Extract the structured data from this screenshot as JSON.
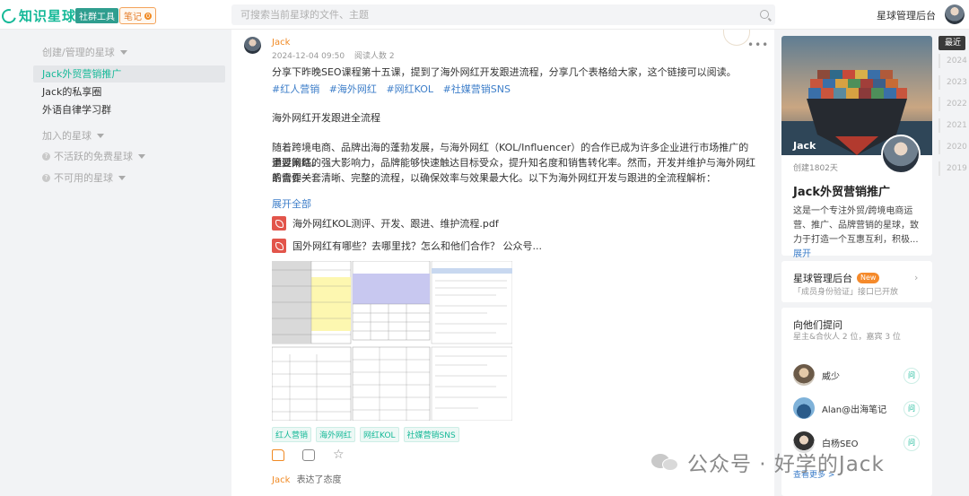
{
  "header": {
    "logo_text": "知识星球",
    "tool_badge": "社群工具",
    "note_badge": "笔记",
    "note_count": "0",
    "search_placeholder": "可搜索当前星球的文件、主题",
    "admin_link": "星球管理后台"
  },
  "sidebar": {
    "section_created": "创建/管理的星球",
    "items": [
      {
        "label": "Jack外贸营销推广",
        "active": true
      },
      {
        "label": "Jack的私享圈",
        "active": false
      },
      {
        "label": "外语自律学习群",
        "active": false
      }
    ],
    "section_joined": "加入的星球",
    "section_inactive": "不活跃的免费星球",
    "section_unavailable": "不可用的星球"
  },
  "post": {
    "author": "Jack",
    "date": "2024-12-04 09:50",
    "readers": "阅读人数 2",
    "intro": "分享下昨晚SEO课程第十五课，提到了海外网红开发跟进流程，分享几个表格给大家，这个链接可以阅读。",
    "hashtags": [
      "#红人营销",
      "#海外网红",
      "#网红KOL",
      "#社媒营销SNS"
    ],
    "heading": "海外网红开发跟进全流程",
    "body_lines": [
      "随着跨境电商、品牌出海的蓬勃发展，与海外网红（KOL/Influencer）的合作已成为许多企业进行市场推广的重要策略。",
      "通过网红的强大影响力，品牌能够快速触达目标受众，提升知名度和销售转化率。然而，开发并维护与海外网红的合作关",
      "系需要一套清晰、完整的流程，以确保效率与效果最大化。以下为海外网红开发与跟进的全流程解析："
    ],
    "expand": "展开全部",
    "files": [
      "海外网红KOL测评、开发、跟进、维护流程.pdf",
      "国外网红有哪些？去哪里找？怎么和他们合作？ 公众号..."
    ],
    "tag_chips": [
      "红人营销",
      "海外网红",
      "网红KOL",
      "社媒营销SNS"
    ],
    "reacted_user": "Jack",
    "reacted_text": "表达了态度"
  },
  "group": {
    "cover_name": "Jack",
    "founded": "创建1802天",
    "title": "Jack外贸营销推广",
    "description": "这是一个专注外贸/跨境电商运营、推广、品牌营销的星球，致力于打造一个互惠互利，积极...",
    "expand": "展开"
  },
  "admin_card": {
    "title": "星球管理后台",
    "badge": "New",
    "subtitle": "「成员身份验证」接口已开放"
  },
  "ask": {
    "title": "向他们提问",
    "subtitle": "星主&合伙人 2 位，嘉宾 3 位",
    "people": [
      {
        "name": "威少",
        "button": "问"
      },
      {
        "name": "Alan@出海笔记",
        "button": "问"
      },
      {
        "name": "白杨SEO",
        "button": "问"
      }
    ],
    "see_more": "查看更多 >"
  },
  "timeline": [
    "最近",
    "2024",
    "2023",
    "2022",
    "2021",
    "2020",
    "2019"
  ],
  "watermark": "公众号 · 好学的Jack",
  "colors": {
    "brand_green": "#16b998",
    "accent_orange": "#f08a24",
    "link_blue": "#3d7ec9"
  }
}
